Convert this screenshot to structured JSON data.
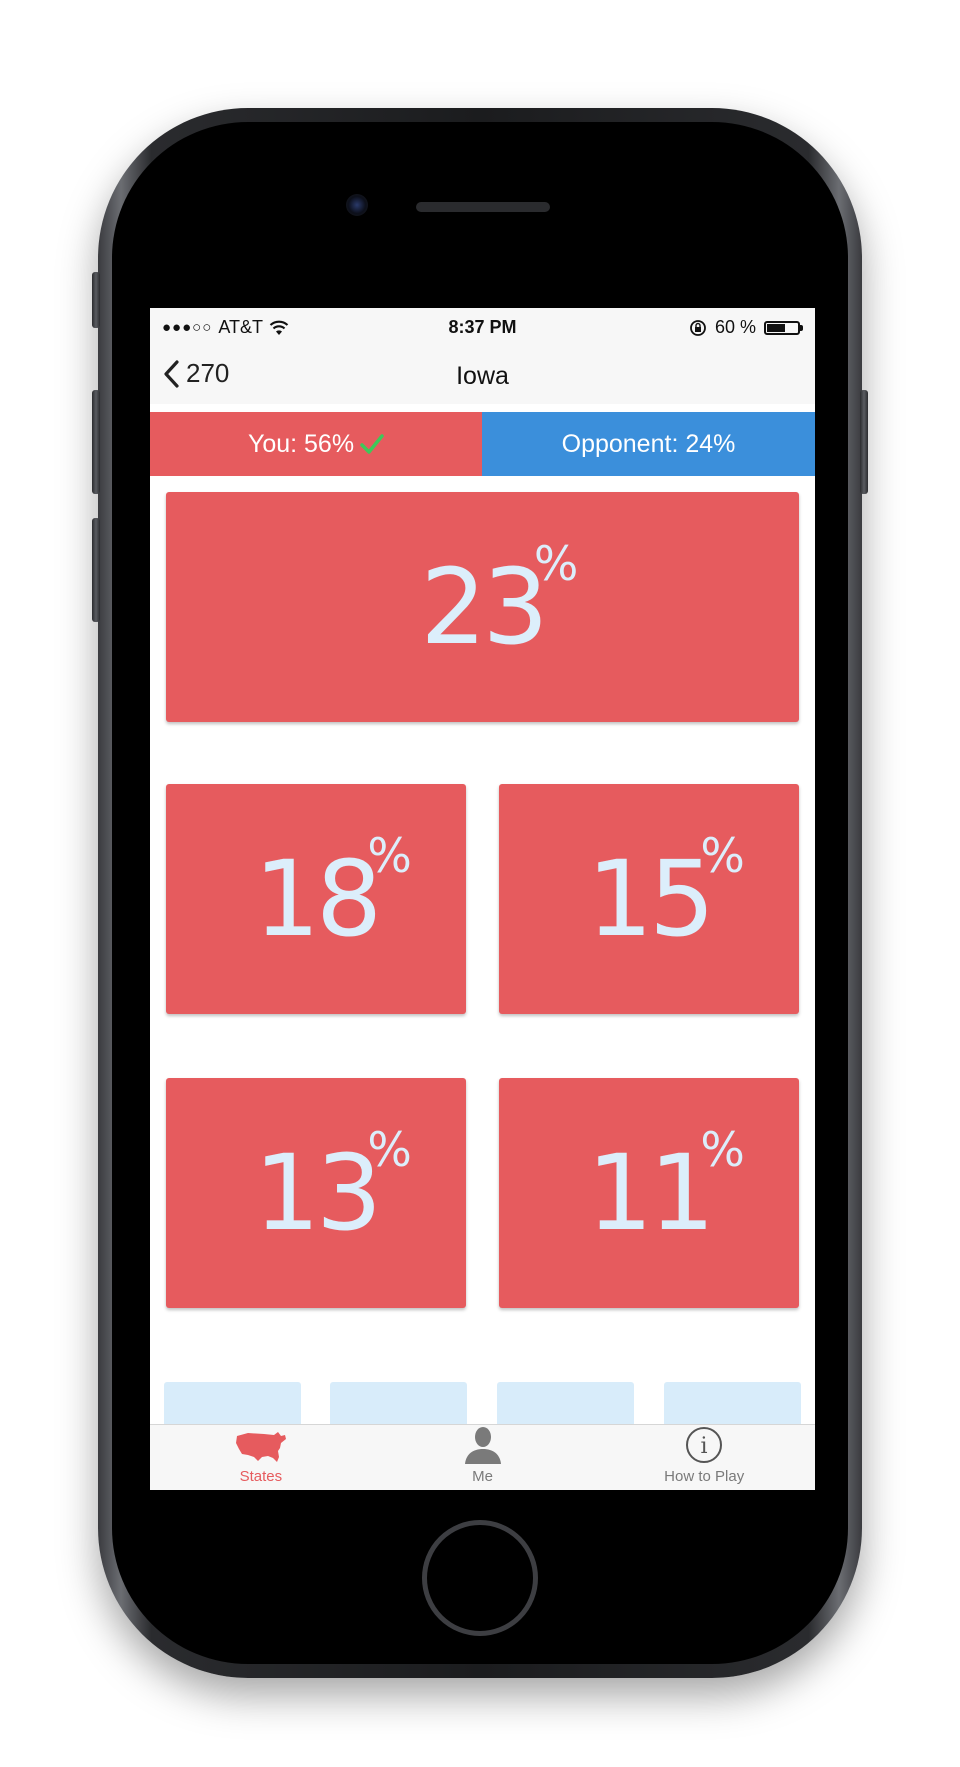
{
  "status_bar": {
    "carrier": "AT&T",
    "time": "8:37 PM",
    "battery": "60 %",
    "battery_level": 0.6,
    "signal_dots": [
      true,
      true,
      true,
      false,
      false
    ]
  },
  "nav": {
    "back_label": "270",
    "title": "Iowa"
  },
  "score": {
    "you": "You: 56%",
    "opponent": "Opponent: 24%",
    "colors": {
      "you": "#e65b5e",
      "opponent": "#3b8fdb",
      "check": "#3ec85a"
    }
  },
  "tiles": [
    {
      "value": "23",
      "unit": "%"
    },
    {
      "value": "18",
      "unit": "%"
    },
    {
      "value": "15",
      "unit": "%"
    },
    {
      "value": "13",
      "unit": "%"
    },
    {
      "value": "11",
      "unit": "%"
    }
  ],
  "tab_bar": {
    "items": [
      {
        "label": "States",
        "icon": "usa-map-icon",
        "active": true
      },
      {
        "label": "Me",
        "icon": "person-icon",
        "active": false
      },
      {
        "label": "How to Play",
        "icon": "info-icon",
        "active": false
      }
    ]
  }
}
